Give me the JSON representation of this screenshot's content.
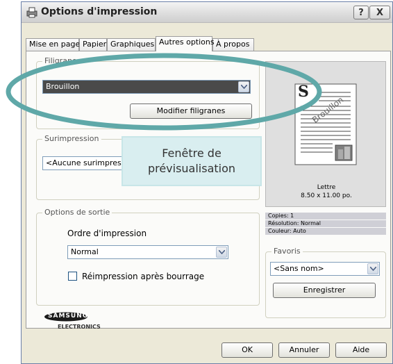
{
  "window": {
    "title": "Options d'impression",
    "help_button": "?",
    "close_button": "X"
  },
  "tabs": [
    {
      "label": "Mise en page"
    },
    {
      "label": "Papier"
    },
    {
      "label": "Graphiques"
    },
    {
      "label": "Autres options"
    },
    {
      "label": "À propos"
    }
  ],
  "watermark": {
    "group_label": "Filigrane",
    "selected": "Brouillon",
    "edit_button": "Modifier filigranes"
  },
  "overlay": {
    "group_label": "Surimpression",
    "selected": "<Aucune surimpression>"
  },
  "output": {
    "group_label": "Options de sortie",
    "order_label": "Ordre d'impression",
    "order_selected": "Normal",
    "reprint_label": "Réimpression après bourrage",
    "reprint_checked": false
  },
  "preview": {
    "page_label": "Lettre",
    "page_size": "8.50 x 11.00 po.",
    "watermark_text": "Brouillon",
    "page_letter": "S",
    "copies": "Copies: 1",
    "resolution": "Résolution: Normal",
    "color": "Couleur: Auto"
  },
  "favorites": {
    "group_label": "Favoris",
    "selected": "<Sans nom>",
    "save_button": "Enregistrer"
  },
  "brand": {
    "line1": "SAMSUNG",
    "line2": "ELECTRONICS"
  },
  "footer": {
    "ok": "OK",
    "cancel": "Annuler",
    "help": "Aide"
  },
  "annotation": {
    "line1": "Fenêtre de",
    "line2": "prévisualisation"
  },
  "colors": {
    "highlight_ellipse": "#5fa8a8",
    "annotation_bg": "#d9eef0",
    "selected_field": "#4a4a4a"
  }
}
